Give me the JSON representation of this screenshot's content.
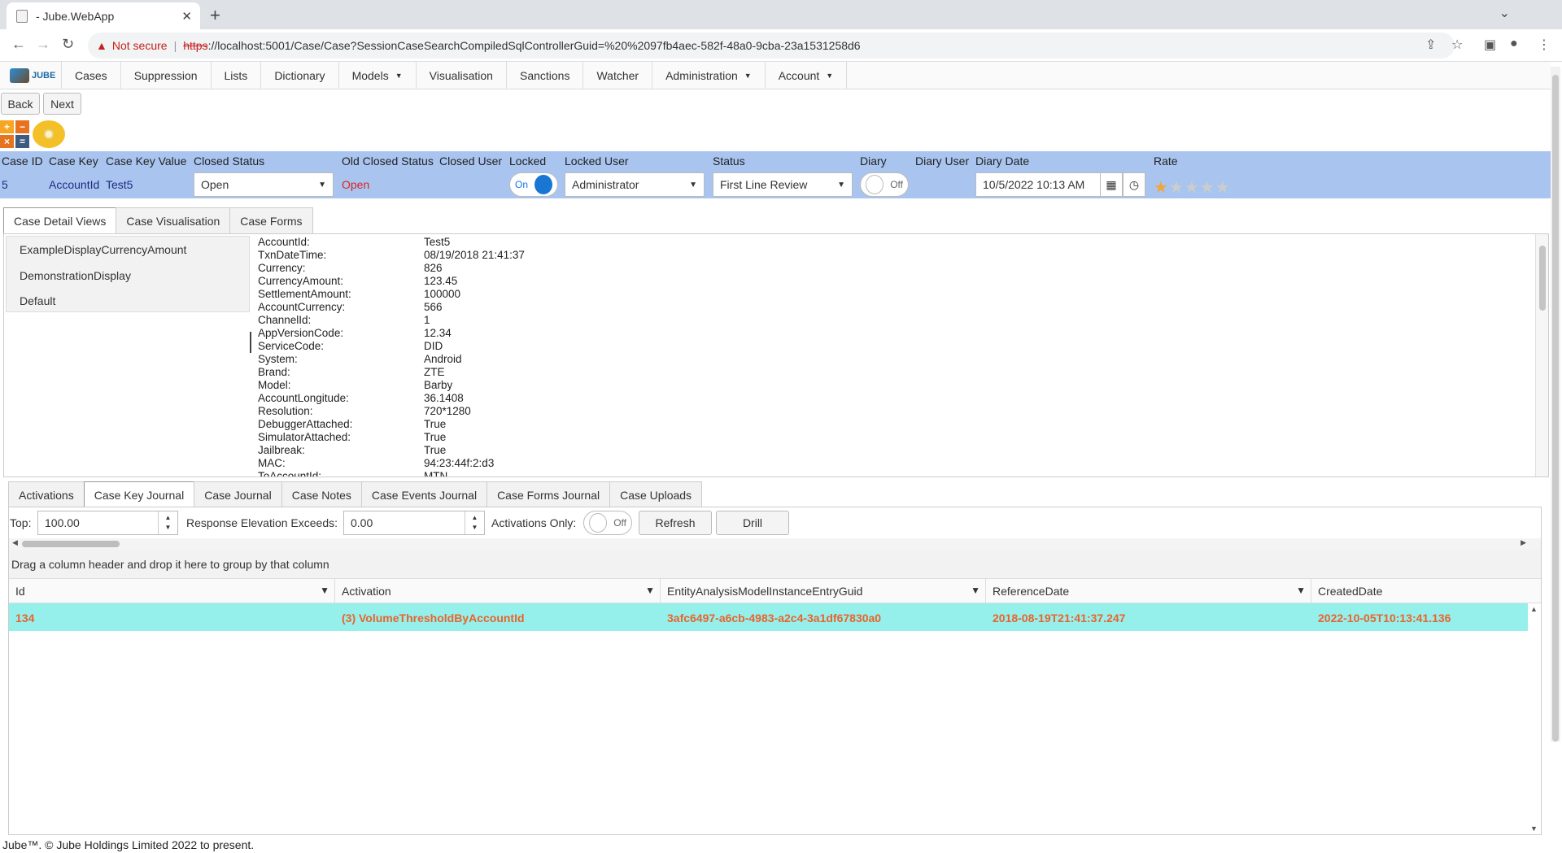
{
  "browser": {
    "tab_title": "- Jube.WebApp",
    "not_secure": "Not secure",
    "url_scheme": "https",
    "url_rest": "://localhost:5001/Case/Case?SessionCaseSearchCompiledSqlControllerGuid=%20%2097fb4aec-582f-48a0-9cba-23a1531258d6"
  },
  "menu": {
    "logo_text": "JUBE",
    "items": [
      "Cases",
      "Suppression",
      "Lists",
      "Dictionary",
      "Models",
      "Visualisation",
      "Sanctions",
      "Watcher",
      "Administration",
      "Account"
    ]
  },
  "nav": {
    "back": "Back",
    "next": "Next"
  },
  "case": {
    "headers": {
      "case_id": "Case ID",
      "case_key": "Case Key",
      "case_key_value": "Case Key Value",
      "closed_status": "Closed Status",
      "old_closed_status": "Old Closed Status",
      "closed_user": "Closed User",
      "locked": "Locked",
      "locked_user": "Locked User",
      "status": "Status",
      "diary": "Diary",
      "diary_user": "Diary User",
      "diary_date": "Diary Date",
      "rate": "Rate"
    },
    "values": {
      "case_id": "5",
      "case_key": "AccountId",
      "case_key_value": "Test5",
      "closed_status": "Open",
      "old_closed_status": "Open",
      "locked_switch": "On",
      "locked_user": "Administrator",
      "status": "First Line Review",
      "diary_switch": "Off",
      "diary_date": "10/5/2022 10:13 AM",
      "rating": 1,
      "rating_max": 5
    }
  },
  "detail_tabs": [
    "Case Detail Views",
    "Case Visualisation",
    "Case Forms"
  ],
  "views": [
    "ExampleDisplayCurrencyAmount",
    "DemonstrationDisplay",
    "Default"
  ],
  "fields": [
    {
      "k": "AccountId:",
      "v": "Test5"
    },
    {
      "k": "TxnDateTime:",
      "v": "08/19/2018 21:41:37"
    },
    {
      "k": "Currency:",
      "v": "826"
    },
    {
      "k": "CurrencyAmount:",
      "v": "123.45"
    },
    {
      "k": "SettlementAmount:",
      "v": "100000"
    },
    {
      "k": "AccountCurrency:",
      "v": "566"
    },
    {
      "k": "ChannelId:",
      "v": "1"
    },
    {
      "k": "AppVersionCode:",
      "v": "12.34"
    },
    {
      "k": "ServiceCode:",
      "v": "DID"
    },
    {
      "k": "System:",
      "v": "Android"
    },
    {
      "k": "Brand:",
      "v": "ZTE"
    },
    {
      "k": "Model:",
      "v": "Barby"
    },
    {
      "k": "AccountLongitude:",
      "v": "36.1408"
    },
    {
      "k": "Resolution:",
      "v": "720*1280"
    },
    {
      "k": "DebuggerAttached:",
      "v": "True"
    },
    {
      "k": "SimulatorAttached:",
      "v": "True"
    },
    {
      "k": "Jailbreak:",
      "v": "True"
    },
    {
      "k": "MAC:",
      "v": "94:23:44f:2:d3"
    },
    {
      "k": "ToAccountId:",
      "v": "MTN"
    }
  ],
  "journal_tabs": [
    "Activations",
    "Case Key Journal",
    "Case Journal",
    "Case Notes",
    "Case Events Journal",
    "Case Forms Journal",
    "Case Uploads"
  ],
  "journal": {
    "top_label": "Top:",
    "top_value": "100.00",
    "elev_label": "Response Elevation Exceeds:",
    "elev_value": "0.00",
    "activations_only_label": "Activations Only:",
    "activations_only_switch": "Off",
    "refresh": "Refresh",
    "drill": "Drill",
    "group_hint": "Drag a column header and drop it here to group by that column",
    "columns": [
      "Id",
      "Activation",
      "EntityAnalysisModelInstanceEntryGuid",
      "ReferenceDate",
      "CreatedDate"
    ],
    "rows": [
      [
        "134",
        "(3) VolumeThresholdByAccountId",
        "3afc6497-a6cb-4983-a2c4-3a1df67830a0",
        "2018-08-19T21:41:37.247",
        "2022-10-05T10:13:41.136"
      ]
    ]
  },
  "footer": "Jube™. © Jube Holdings Limited 2022 to present."
}
